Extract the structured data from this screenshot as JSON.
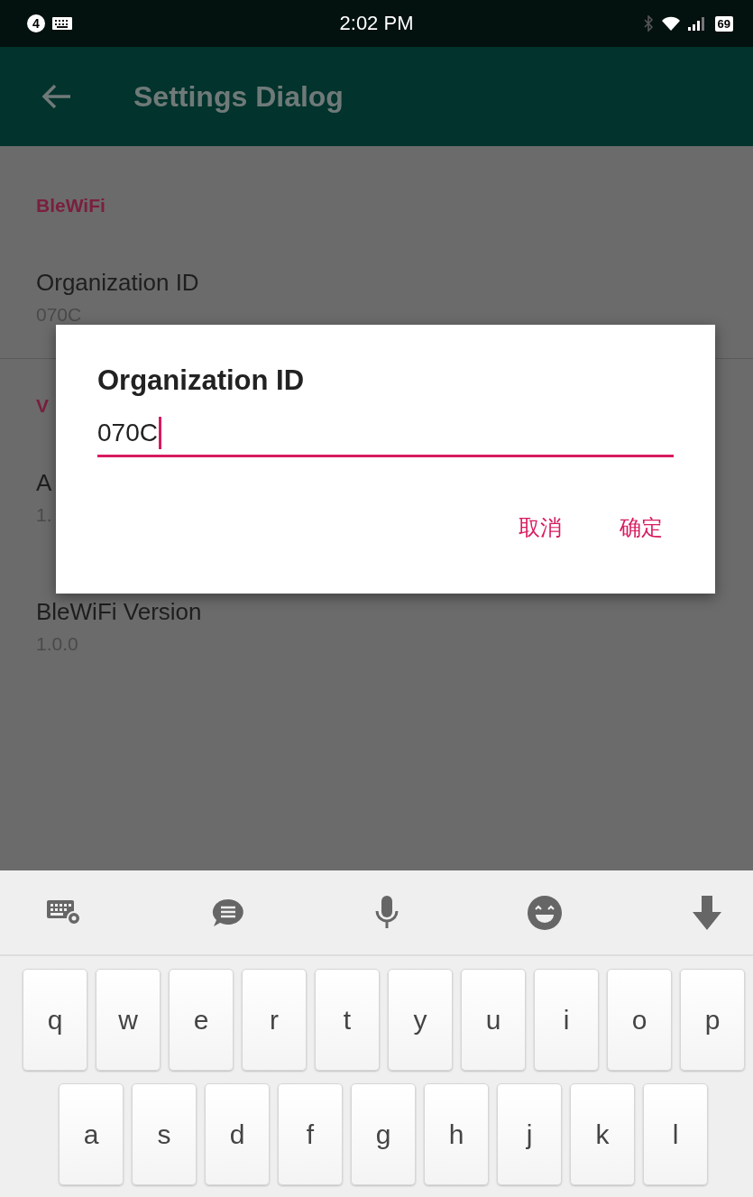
{
  "status_bar": {
    "notification_count": "4",
    "time": "2:02 PM",
    "battery": "69"
  },
  "app_bar": {
    "title": "Settings Dialog"
  },
  "settings": [
    {
      "kind": "header",
      "text": "BleWiFi"
    },
    {
      "kind": "item",
      "title": "Organization ID",
      "summary": "070C",
      "divider": true
    },
    {
      "kind": "header",
      "text": "V"
    },
    {
      "kind": "item",
      "title": "A",
      "summary": "1.",
      "divider": false
    },
    {
      "kind": "item",
      "title": "BleWiFi Version",
      "summary": "1.0.0",
      "divider": false
    }
  ],
  "dialog": {
    "title": "Organization ID",
    "value": "070C",
    "buttons": [
      "取消",
      "确定"
    ]
  },
  "keyboard": {
    "rows": [
      [
        "q",
        "w",
        "e",
        "r",
        "t",
        "y",
        "u",
        "i",
        "o",
        "p"
      ],
      [
        "a",
        "s",
        "d",
        "f",
        "g",
        "h",
        "j",
        "k",
        "l"
      ]
    ]
  }
}
